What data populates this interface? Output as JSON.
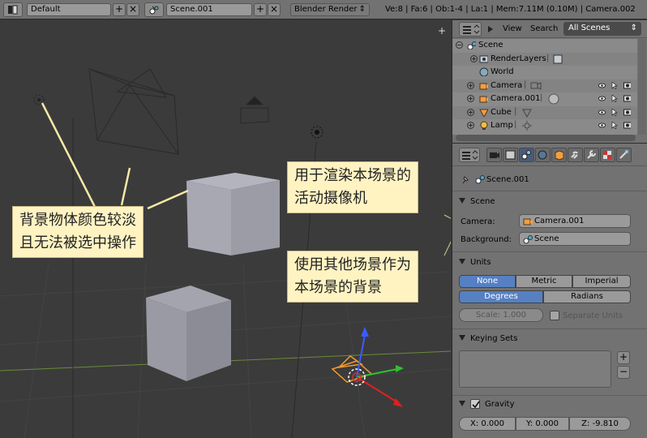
{
  "topbar": {
    "layout_name": "Default",
    "scene_name": "Scene.001",
    "render_engine": "Blender Render",
    "status": "Ve:8 | Fa:6 | Ob:1-4 | La:1 | Mem:7.11M (0.10M) | Camera.002",
    "add_glyph": "+",
    "close_glyph": "×",
    "dropdown_glyph": "⇕"
  },
  "viewport": {
    "callout_left": [
      "背景物体颜色较淡",
      "且无法被选中操作"
    ],
    "callout_top": [
      "用于渲染本场景的",
      "活动摄像机"
    ],
    "callout_mid": [
      "使用其他场景作为",
      "本场景的背景"
    ],
    "plus_glyph": "+"
  },
  "outliner": {
    "menu_view": "View",
    "menu_search": "Search",
    "scenes_select": "All Scenes",
    "tree": [
      {
        "label": "Scene",
        "icon": "scene-icon"
      },
      {
        "label": "RenderLayers",
        "icon": "render-layers-icon"
      },
      {
        "label": "World",
        "icon": "world-icon"
      },
      {
        "label": "Camera",
        "icon": "camera-object-icon"
      },
      {
        "label": "Camera.001",
        "icon": "camera-object-icon"
      },
      {
        "label": "Cube",
        "icon": "mesh-object-icon"
      },
      {
        "label": "Lamp",
        "icon": "lamp-object-icon"
      }
    ]
  },
  "properties": {
    "context_scene": "Scene.001",
    "scene_panel": {
      "title": "Scene",
      "camera_label": "Camera:",
      "camera_value": "Camera.001",
      "background_label": "Background:",
      "background_value": "Scene"
    },
    "units_panel": {
      "title": "Units",
      "systems": [
        "None",
        "Metric",
        "Imperial"
      ],
      "active_system": "None",
      "rotation": [
        "Degrees",
        "Radians"
      ],
      "active_rotation": "Degrees",
      "scale": "Scale: 1.000",
      "separate_units": "Separate Units"
    },
    "keying_panel": {
      "title": "Keying Sets",
      "add": "+",
      "remove": "−"
    },
    "gravity_panel": {
      "title": "Gravity",
      "x": "X: 0.000",
      "y": "Y: 0.000",
      "z": "Z: -9.810"
    }
  },
  "colors": {
    "callout_bg": "#fff3c2",
    "active_button": "#5680c2",
    "panel_bg": "#727272",
    "viewport_bg": "#3b3b3b"
  }
}
